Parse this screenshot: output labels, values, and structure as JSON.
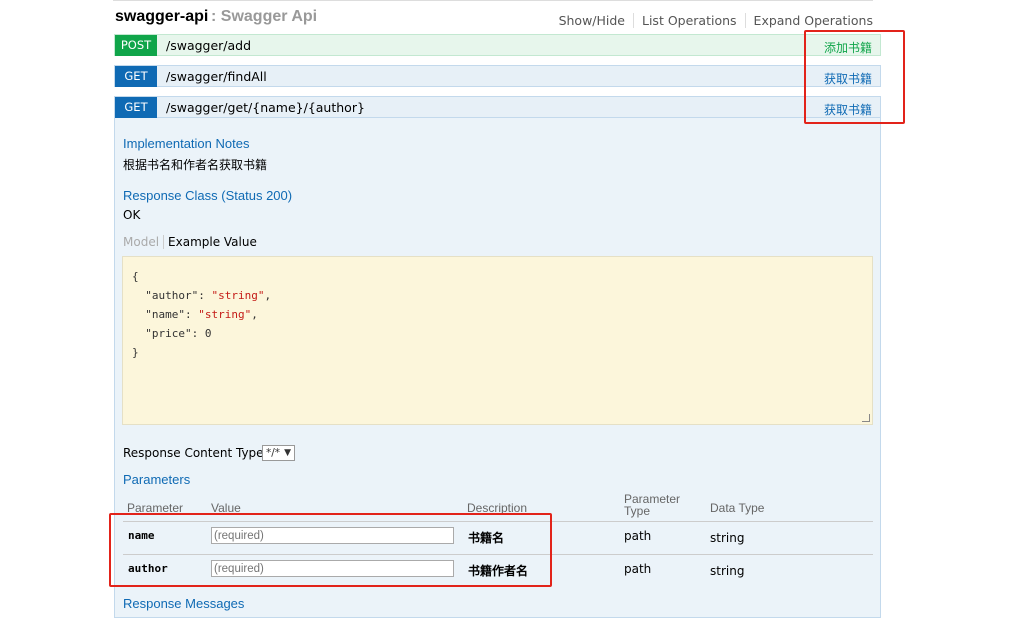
{
  "api": {
    "name": "swagger-api",
    "separator": " : ",
    "description": "Swagger Api",
    "links": [
      "Show/Hide",
      "List Operations",
      "Expand Operations"
    ]
  },
  "operations": [
    {
      "method": "POST",
      "path": "/swagger/add",
      "summary": "添加书籍",
      "color": "#10a54a"
    },
    {
      "method": "GET",
      "path": "/swagger/findAll",
      "summary": "获取书籍",
      "color": "#0f6ab4"
    },
    {
      "method": "GET",
      "path": "/swagger/get/{name}/{author}",
      "summary": "获取书籍",
      "color": "#0f6ab4"
    }
  ],
  "details": {
    "impl_title": "Implementation Notes",
    "impl_text": "根据书名和作者名获取书籍",
    "response_class_title": "Response Class (Status 200)",
    "response_class_text": "OK",
    "tab_model": "Model",
    "tab_example": "Example Value",
    "example": {
      "open": "{",
      "lines": [
        {
          "key": "\"author\"",
          "value": "\"string\"",
          "comma": ","
        },
        {
          "key": "\"name\"",
          "value": "\"string\"",
          "comma": ","
        },
        {
          "key": "\"price\"",
          "value": "0",
          "comma": ""
        }
      ],
      "close": "}"
    },
    "response_content_type_label": "Response Content Type",
    "response_content_type_value": "*/*",
    "parameters_title": "Parameters",
    "param_headers": {
      "parameter": "Parameter",
      "value": "Value",
      "description": "Description",
      "param_type_1": "Parameter",
      "param_type_2": "Type",
      "data_type": "Data Type"
    },
    "params": [
      {
        "name": "name",
        "placeholder": "(required)",
        "description": "书籍名",
        "type": "path",
        "data_type": "string"
      },
      {
        "name": "author",
        "placeholder": "(required)",
        "description": "书籍作者名",
        "type": "path",
        "data_type": "string"
      }
    ],
    "response_messages_title": "Response Messages"
  },
  "colors": {
    "post": "#10a54a",
    "get": "#0f6ab4",
    "highlight": "#e2231a"
  }
}
